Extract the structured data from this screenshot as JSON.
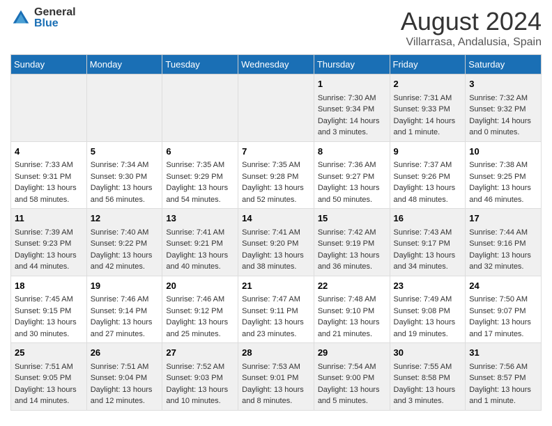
{
  "logo": {
    "general": "General",
    "blue": "Blue"
  },
  "title": "August 2024",
  "subtitle": "Villarrasa, Andalusia, Spain",
  "weekdays": [
    "Sunday",
    "Monday",
    "Tuesday",
    "Wednesday",
    "Thursday",
    "Friday",
    "Saturday"
  ],
  "weeks": [
    [
      {
        "day": "",
        "info": ""
      },
      {
        "day": "",
        "info": ""
      },
      {
        "day": "",
        "info": ""
      },
      {
        "day": "",
        "info": ""
      },
      {
        "day": "1",
        "info": "Sunrise: 7:30 AM\nSunset: 9:34 PM\nDaylight: 14 hours\nand 3 minutes."
      },
      {
        "day": "2",
        "info": "Sunrise: 7:31 AM\nSunset: 9:33 PM\nDaylight: 14 hours\nand 1 minute."
      },
      {
        "day": "3",
        "info": "Sunrise: 7:32 AM\nSunset: 9:32 PM\nDaylight: 14 hours\nand 0 minutes."
      }
    ],
    [
      {
        "day": "4",
        "info": "Sunrise: 7:33 AM\nSunset: 9:31 PM\nDaylight: 13 hours\nand 58 minutes."
      },
      {
        "day": "5",
        "info": "Sunrise: 7:34 AM\nSunset: 9:30 PM\nDaylight: 13 hours\nand 56 minutes."
      },
      {
        "day": "6",
        "info": "Sunrise: 7:35 AM\nSunset: 9:29 PM\nDaylight: 13 hours\nand 54 minutes."
      },
      {
        "day": "7",
        "info": "Sunrise: 7:35 AM\nSunset: 9:28 PM\nDaylight: 13 hours\nand 52 minutes."
      },
      {
        "day": "8",
        "info": "Sunrise: 7:36 AM\nSunset: 9:27 PM\nDaylight: 13 hours\nand 50 minutes."
      },
      {
        "day": "9",
        "info": "Sunrise: 7:37 AM\nSunset: 9:26 PM\nDaylight: 13 hours\nand 48 minutes."
      },
      {
        "day": "10",
        "info": "Sunrise: 7:38 AM\nSunset: 9:25 PM\nDaylight: 13 hours\nand 46 minutes."
      }
    ],
    [
      {
        "day": "11",
        "info": "Sunrise: 7:39 AM\nSunset: 9:23 PM\nDaylight: 13 hours\nand 44 minutes."
      },
      {
        "day": "12",
        "info": "Sunrise: 7:40 AM\nSunset: 9:22 PM\nDaylight: 13 hours\nand 42 minutes."
      },
      {
        "day": "13",
        "info": "Sunrise: 7:41 AM\nSunset: 9:21 PM\nDaylight: 13 hours\nand 40 minutes."
      },
      {
        "day": "14",
        "info": "Sunrise: 7:41 AM\nSunset: 9:20 PM\nDaylight: 13 hours\nand 38 minutes."
      },
      {
        "day": "15",
        "info": "Sunrise: 7:42 AM\nSunset: 9:19 PM\nDaylight: 13 hours\nand 36 minutes."
      },
      {
        "day": "16",
        "info": "Sunrise: 7:43 AM\nSunset: 9:17 PM\nDaylight: 13 hours\nand 34 minutes."
      },
      {
        "day": "17",
        "info": "Sunrise: 7:44 AM\nSunset: 9:16 PM\nDaylight: 13 hours\nand 32 minutes."
      }
    ],
    [
      {
        "day": "18",
        "info": "Sunrise: 7:45 AM\nSunset: 9:15 PM\nDaylight: 13 hours\nand 30 minutes."
      },
      {
        "day": "19",
        "info": "Sunrise: 7:46 AM\nSunset: 9:14 PM\nDaylight: 13 hours\nand 27 minutes."
      },
      {
        "day": "20",
        "info": "Sunrise: 7:46 AM\nSunset: 9:12 PM\nDaylight: 13 hours\nand 25 minutes."
      },
      {
        "day": "21",
        "info": "Sunrise: 7:47 AM\nSunset: 9:11 PM\nDaylight: 13 hours\nand 23 minutes."
      },
      {
        "day": "22",
        "info": "Sunrise: 7:48 AM\nSunset: 9:10 PM\nDaylight: 13 hours\nand 21 minutes."
      },
      {
        "day": "23",
        "info": "Sunrise: 7:49 AM\nSunset: 9:08 PM\nDaylight: 13 hours\nand 19 minutes."
      },
      {
        "day": "24",
        "info": "Sunrise: 7:50 AM\nSunset: 9:07 PM\nDaylight: 13 hours\nand 17 minutes."
      }
    ],
    [
      {
        "day": "25",
        "info": "Sunrise: 7:51 AM\nSunset: 9:05 PM\nDaylight: 13 hours\nand 14 minutes."
      },
      {
        "day": "26",
        "info": "Sunrise: 7:51 AM\nSunset: 9:04 PM\nDaylight: 13 hours\nand 12 minutes."
      },
      {
        "day": "27",
        "info": "Sunrise: 7:52 AM\nSunset: 9:03 PM\nDaylight: 13 hours\nand 10 minutes."
      },
      {
        "day": "28",
        "info": "Sunrise: 7:53 AM\nSunset: 9:01 PM\nDaylight: 13 hours\nand 8 minutes."
      },
      {
        "day": "29",
        "info": "Sunrise: 7:54 AM\nSunset: 9:00 PM\nDaylight: 13 hours\nand 5 minutes."
      },
      {
        "day": "30",
        "info": "Sunrise: 7:55 AM\nSunset: 8:58 PM\nDaylight: 13 hours\nand 3 minutes."
      },
      {
        "day": "31",
        "info": "Sunrise: 7:56 AM\nSunset: 8:57 PM\nDaylight: 13 hours\nand 1 minute."
      }
    ]
  ]
}
